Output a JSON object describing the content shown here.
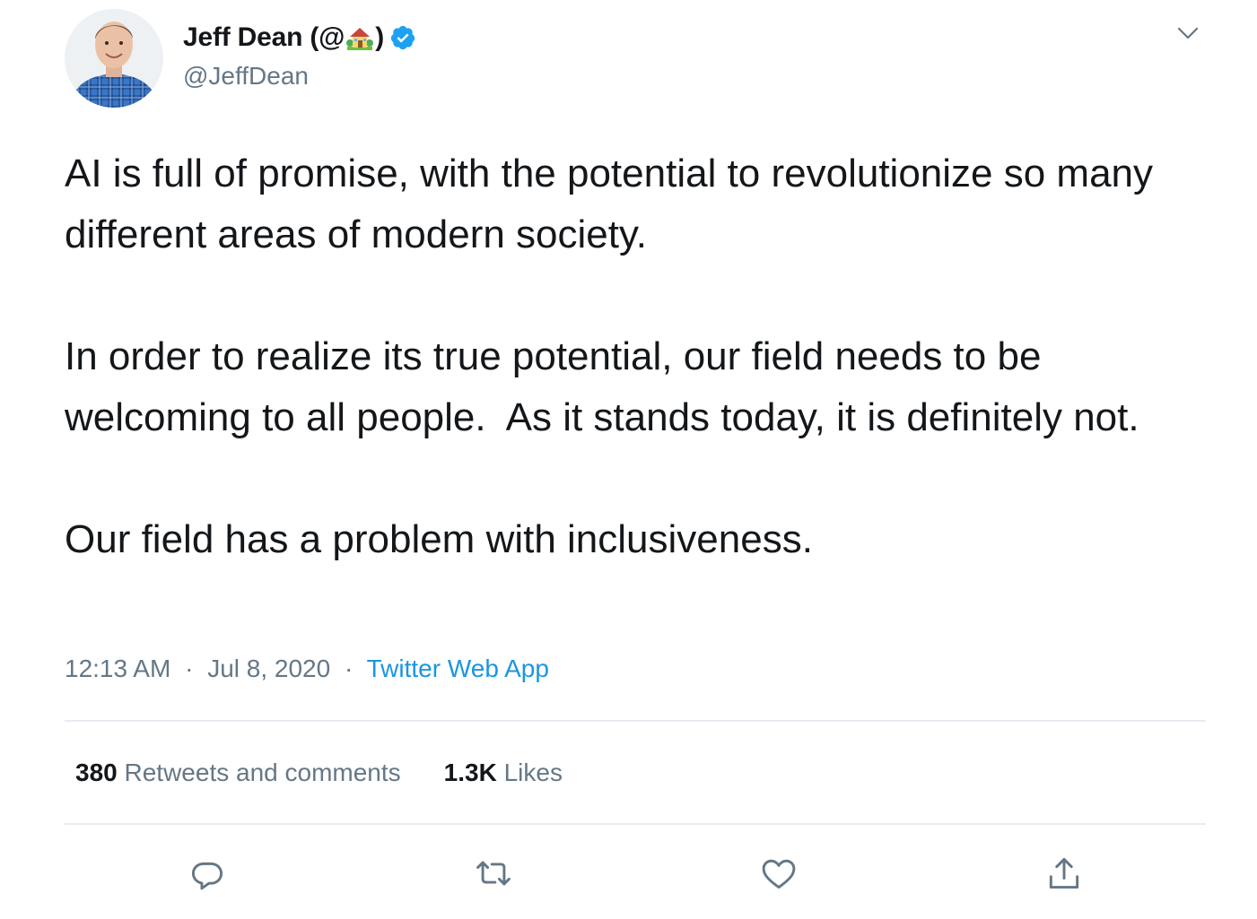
{
  "author": {
    "display_name_prefix": "Jeff Dean (@",
    "display_name_suffix": ")",
    "name_emoji_icon": "house-with-garden-icon",
    "verified_icon": "verified-badge-icon",
    "handle": "@JeffDean"
  },
  "tweet": {
    "paragraphs": [
      "AI is full of promise, with the potential to revolutionize so many different areas of modern society.",
      "In order to realize its true potential, our field needs to be welcoming to all people.  As it stands today, it is definitely not.",
      "Our field has a problem with inclusiveness."
    ],
    "time": "12:13 AM",
    "date": "Jul 8, 2020",
    "separator": "·",
    "source": "Twitter Web App"
  },
  "stats": {
    "retweets_count": "380",
    "retweets_label": "Retweets and comments",
    "likes_count": "1.3K",
    "likes_label": "Likes"
  },
  "actions": {
    "reply_icon": "reply-icon",
    "retweet_icon": "retweet-icon",
    "like_icon": "heart-icon",
    "share_icon": "share-icon"
  },
  "colors": {
    "text": "#14171a",
    "secondary": "#657786",
    "link": "#1b95e0",
    "divider": "#e6ecf0",
    "verified": "#1da1f2"
  }
}
